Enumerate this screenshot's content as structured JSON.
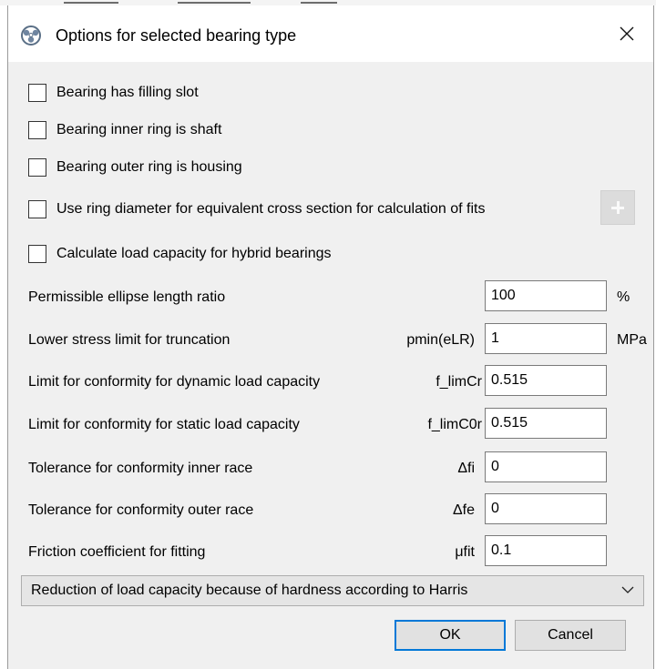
{
  "window": {
    "title": "Options for selected bearing type",
    "icon": "bearing-app-icon",
    "close_icon": "close-icon"
  },
  "checkboxes": [
    {
      "label": "Bearing has filling slot",
      "checked": false
    },
    {
      "label": "Bearing inner ring is shaft",
      "checked": false
    },
    {
      "label": "Bearing outer ring is housing",
      "checked": false
    },
    {
      "label": "Use ring diameter for equivalent cross section for calculation of fits",
      "checked": false
    },
    {
      "label": "Calculate load capacity for hybrid bearings",
      "checked": false
    }
  ],
  "plus_button_icon": "plus-icon",
  "params": [
    {
      "label": "Permissible ellipse length ratio",
      "symbol": "",
      "value": "100",
      "unit": "%"
    },
    {
      "label": "Lower stress limit for truncation",
      "symbol": "pmin(eLR)",
      "value": "1",
      "unit": "MPa"
    },
    {
      "label": "Limit for conformity for dynamic load capacity",
      "symbol": "f_limCr",
      "value": "0.515",
      "unit": ""
    },
    {
      "label": "Limit for conformity for static load capacity",
      "symbol": "f_limC0r",
      "value": "0.515",
      "unit": ""
    },
    {
      "label": "Tolerance for conformity inner race",
      "symbol": "Δfi",
      "value": "0",
      "unit": ""
    },
    {
      "label": "Tolerance for conformity outer race",
      "symbol": "Δfe",
      "value": "0",
      "unit": ""
    },
    {
      "label": "Friction coefficient for fitting",
      "symbol": "μfit",
      "value": "0.1",
      "unit": ""
    }
  ],
  "dropdown": {
    "selected": "Reduction of load capacity because of hardness according to Harris",
    "icon": "chevron-down-icon"
  },
  "buttons": {
    "ok": "OK",
    "cancel": "Cancel"
  }
}
